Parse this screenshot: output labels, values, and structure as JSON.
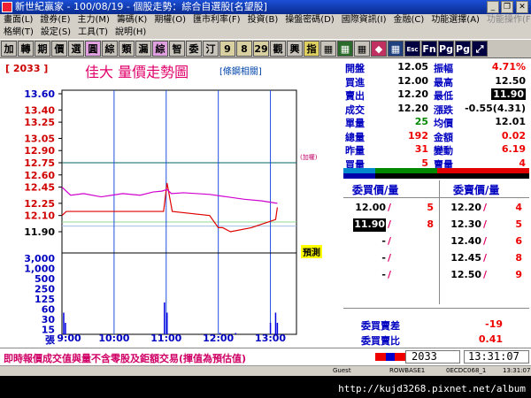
{
  "window": {
    "title": "新世紀贏家 - 100/08/19 - 個股走勢：綜合自選股[名望股]",
    "minimize": "_",
    "restore": "❐",
    "close": "✕"
  },
  "menu1": [
    "畫面(L)",
    "證券(E)",
    "主力(M)",
    "籌碼(K)",
    "期權(O)",
    "匯市利率(F)",
    "投資(B)",
    "操盤密碼(D)",
    "國際資訊(I)",
    "金融(C)",
    "功能選擇(A)",
    "功能操作(F)"
  ],
  "menu2": [
    "格網(T)",
    "設定(S)",
    "工具(T)",
    "說明(H)"
  ],
  "toolbar": {
    "buttons": [
      {
        "label": "加",
        "color": "#c8c4bc",
        "dark": false
      },
      {
        "label": "轉",
        "color": "#c8c4bc",
        "dark": false
      },
      {
        "label": "期",
        "color": "#c8c4bc",
        "dark": false
      },
      {
        "label": "價",
        "color": "#c8c4bc",
        "dark": false
      },
      {
        "label": "選",
        "color": "#c8c4bc",
        "dark": false
      },
      {
        "label": "圓",
        "color": "#e0a0e0",
        "dark": false
      },
      {
        "label": "綜",
        "color": "#c8c4bc",
        "dark": false
      },
      {
        "label": "類",
        "color": "#c8c4bc",
        "dark": false
      },
      {
        "label": "漏",
        "color": "#c8c4bc",
        "dark": false
      },
      {
        "label": "綜",
        "color": "#e0a0e0",
        "dark": false
      },
      {
        "label": "智",
        "color": "#c8c4bc",
        "dark": false
      },
      {
        "label": "委",
        "color": "#c8c4bc",
        "dark": false
      },
      {
        "label": "汀",
        "color": "#c8c4bc",
        "dark": false
      },
      {
        "label": "9",
        "color": "#d8d0a0",
        "dark": false
      },
      {
        "label": "8",
        "color": "#d8d0a0",
        "dark": false
      },
      {
        "label": "29",
        "color": "#d8d0a0",
        "dark": false
      },
      {
        "label": "觀",
        "color": "#c8c4bc",
        "dark": false
      },
      {
        "label": "興",
        "color": "#c8c4bc",
        "dark": false
      },
      {
        "label": "指",
        "color": "#e0d060",
        "dark": false
      },
      {
        "label": "▦",
        "color": "#c8c4bc",
        "dark": false
      },
      {
        "label": "▦",
        "color": "#2a6a2a",
        "dark": true
      },
      {
        "label": "▦",
        "color": "#c8c4bc",
        "dark": false
      },
      {
        "label": "◆",
        "color": "#c03060",
        "dark": true
      },
      {
        "label": "▦",
        "color": "#204080",
        "dark": true
      },
      {
        "label": "Esc",
        "color": "#000040",
        "dark": true
      },
      {
        "label": "Fn",
        "color": "#000040",
        "dark": true
      },
      {
        "label": "Pg",
        "color": "#000040",
        "dark": true
      },
      {
        "label": "Pg",
        "color": "#000040",
        "dark": true
      },
      {
        "label": "⤢",
        "color": "#000040",
        "dark": true
      }
    ]
  },
  "chart_panel": {
    "code": "[ 2033 ]",
    "name": "佳大  量價走勢圖",
    "tag": "[條鋼相關]",
    "notice_badge": "預測",
    "ref_label": "(加權)"
  },
  "chart_data": {
    "type": "line",
    "x_ticks": [
      "9:00",
      "10:00",
      "11:00",
      "12:00",
      "13:00"
    ],
    "price_ticks": [
      13.6,
      13.4,
      13.25,
      13.05,
      12.9,
      12.75,
      12.6,
      12.45,
      12.25,
      12.1,
      11.9
    ],
    "volume_ticks": [
      "3,000",
      "1,000",
      "500",
      "250",
      "125",
      "60",
      "30",
      "15",
      "張"
    ],
    "ylim": [
      11.9,
      13.6
    ],
    "reference_price": 12.75,
    "series": [
      {
        "color": "#e00000",
        "x": [
          0,
          5,
          30,
          100,
          117,
          121,
          127,
          170,
          180,
          185,
          194,
          218,
          232,
          246,
          248
        ],
        "y": [
          12.1,
          12.15,
          12.15,
          12.15,
          12.15,
          12.5,
          12.15,
          12.1,
          11.95,
          11.95,
          11.9,
          11.95,
          12.0,
          12.05,
          12.2
        ]
      },
      {
        "color": "#d000d0",
        "x": [
          0,
          10,
          25,
          45,
          70,
          90,
          105,
          115,
          121,
          126,
          140,
          170,
          190,
          210,
          230,
          248
        ],
        "y": [
          12.45,
          12.35,
          12.37,
          12.33,
          12.37,
          12.35,
          12.39,
          12.4,
          12.42,
          12.37,
          12.38,
          12.36,
          12.33,
          12.3,
          12.28,
          12.25
        ]
      }
    ],
    "volume": [
      {
        "x": 2,
        "v": 60
      },
      {
        "x": 4,
        "v": 30
      },
      {
        "x": 118,
        "v": 125
      },
      {
        "x": 121,
        "v": 60
      },
      {
        "x": 182,
        "v": 15
      },
      {
        "x": 200,
        "v": 15
      },
      {
        "x": 240,
        "v": 30
      },
      {
        "x": 246,
        "v": 60
      },
      {
        "x": 248,
        "v": 30
      }
    ]
  },
  "quote": {
    "rows": [
      {
        "l1": "開盤",
        "v1": "12.05",
        "c1": "",
        "l2": "振幅",
        "v2": "4.71%",
        "c2": "red"
      },
      {
        "l1": "買進",
        "v1": "12.00",
        "c1": "",
        "l2": "最高",
        "v2": "12.50",
        "c2": ""
      },
      {
        "l1": "賣出",
        "v1": "12.20",
        "c1": "",
        "l2": "最低",
        "v2": "11.90",
        "c2": "low"
      },
      {
        "l1": "成交",
        "v1": "12.20",
        "c1": "",
        "l2": "漲跌",
        "v2": "-0.55(4.31)",
        "c2": ""
      },
      {
        "l1": "單量",
        "v1": "25",
        "c1": "green",
        "l2": "均價",
        "v2": "12.01",
        "c2": ""
      },
      {
        "l1": "總量",
        "v1": "192",
        "c1": "red",
        "l2": "金額",
        "v2": "0.02",
        "c2": "red"
      },
      {
        "l1": "昨量",
        "v1": "31",
        "c1": "red",
        "l2": "變動",
        "v2": "6.19",
        "c2": "red"
      },
      {
        "l1": "買量",
        "v1": "5",
        "c1": "red",
        "l2": "賣量",
        "v2": "4",
        "c2": "red"
      }
    ]
  },
  "orderbook": {
    "bid_header": "委買價/量",
    "ask_header": "委賣價/量",
    "bids": [
      {
        "price": "12.00",
        "qty": "5"
      },
      {
        "price": "11.90",
        "qty": "8"
      },
      {
        "price": "-",
        "qty": ""
      },
      {
        "price": "-",
        "qty": ""
      },
      {
        "price": "-",
        "qty": ""
      }
    ],
    "asks": [
      {
        "price": "12.20",
        "qty": "4"
      },
      {
        "price": "12.30",
        "qty": "5"
      },
      {
        "price": "12.40",
        "qty": "6"
      },
      {
        "price": "12.45",
        "qty": "8"
      },
      {
        "price": "12.50",
        "qty": "9"
      }
    ],
    "diff_label": "委買賣差",
    "diff_value": "-19",
    "ratio_label": "委買賣比",
    "ratio_value": "0.41"
  },
  "footer": {
    "notice": "即時報價成交值與量不含零股及鉅額交易(揮值為預估值)",
    "code": "2033",
    "time": "13:31:07"
  },
  "statusbar": {
    "guest": "Guest",
    "base": "ROWBASE1",
    "conn": "0ECDC068_1",
    "clock": "13:31:07"
  },
  "watermark_url": "http://kujd3268.pixnet.net/album"
}
